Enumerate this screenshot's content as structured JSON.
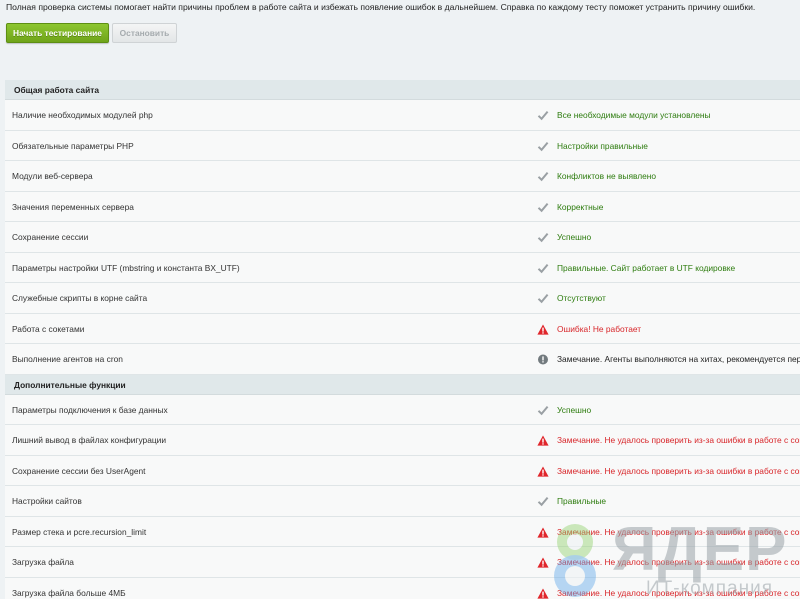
{
  "intro_text": "Полная проверка системы помогает найти причины проблем в работе сайта и избежать появление ошибок в дальнейшем. Справка по каждому тесту поможет устранить причину ошибки.",
  "buttons": {
    "start_label": "Начать тестирование",
    "stop_label": "Остановить"
  },
  "colors": {
    "ok": "#2d7c0e",
    "error": "#d8262a",
    "note": "#222222",
    "start_button": "#7ab324"
  },
  "sections": [
    {
      "title": "Общая работа сайта",
      "rows": [
        {
          "name": "Наличие необходимых модулей php",
          "status": "ok",
          "icon": "check-icon",
          "result": "Все необходимые модули установлены"
        },
        {
          "name": "Обязательные параметры PHP",
          "status": "ok",
          "icon": "check-icon",
          "result": "Настройки правильные"
        },
        {
          "name": "Модули веб-сервера",
          "status": "ok",
          "icon": "check-icon",
          "result": "Конфликтов не выявлено"
        },
        {
          "name": "Значения переменных сервера",
          "status": "ok",
          "icon": "check-icon",
          "result": "Корректные"
        },
        {
          "name": "Сохранение сессии",
          "status": "ok",
          "icon": "check-icon",
          "result": "Успешно"
        },
        {
          "name": "Параметры настройки UTF (mbstring и константа BX_UTF)",
          "status": "ok",
          "icon": "check-icon",
          "result": "Правильные. Сайт работает в UTF кодировке"
        },
        {
          "name": "Служебные скрипты в корне сайта",
          "status": "ok",
          "icon": "check-icon",
          "result": "Отсутствуют"
        },
        {
          "name": "Работа с сокетами",
          "status": "error",
          "icon": "warning-icon",
          "result": "Ошибка! Не работает"
        },
        {
          "name": "Выполнение агентов на cron",
          "status": "note",
          "icon": "info-icon",
          "result": "Замечание. Агенты выполняются на хитах, рекомендуется перев"
        }
      ]
    },
    {
      "title": "Дополнительные функции",
      "rows": [
        {
          "name": "Параметры подключения к базе данных",
          "status": "ok",
          "icon": "check-icon",
          "result": "Успешно"
        },
        {
          "name": "Лишний вывод в файлах конфигурации",
          "status": "error",
          "icon": "warning-icon",
          "result": "Замечание. Не удалось проверить из-за ошибки в работе с сокет"
        },
        {
          "name": "Сохранение сессии без UserAgent",
          "status": "error",
          "icon": "warning-icon",
          "result": "Замечание. Не удалось проверить из-за ошибки в работе с сокет"
        },
        {
          "name": "Настройки сайтов",
          "status": "ok",
          "icon": "check-icon",
          "result": "Правильные"
        },
        {
          "name": "Размер стека и pcre.recursion_limit",
          "status": "error",
          "icon": "warning-icon",
          "result": "Замечание. Не удалось проверить из-за ошибки в работе с сокет"
        },
        {
          "name": "Загрузка файла",
          "status": "error",
          "icon": "warning-icon",
          "result": "Замечание. Не удалось проверить из-за ошибки в работе с сокет"
        },
        {
          "name": "Загрузка файла больше 4МБ",
          "status": "error",
          "icon": "warning-icon",
          "result": "Замечание. Не удалось проверить из-за ошибки в работе с сокет"
        }
      ]
    }
  ],
  "watermark": {
    "digit": "8",
    "brand": "ЯДЕР",
    "subtitle": "ИТ-компания"
  }
}
